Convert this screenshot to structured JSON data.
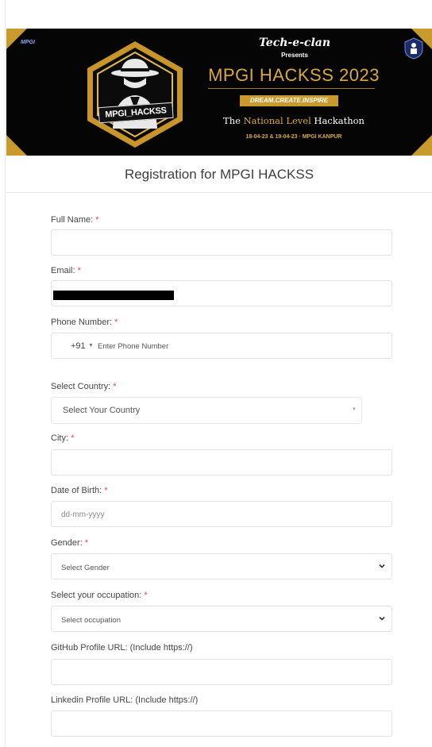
{
  "banner": {
    "org": "Tech-e-clan",
    "presents": "Presents",
    "event_title": "MPGI HACKSS 2023",
    "tagline": "DREAM.CREATE.INSPIRE",
    "national_prefix": "The ",
    "national_highlight": "National Level",
    "national_suffix": " Hackathon",
    "dates": "18-04-23 & 19-04-23  ·  MPGI KANPUR",
    "hex_label": "MPGI_HACKSS",
    "left_logo": "MPGI",
    "right_logo_text": "TECH-E-CLAN",
    "colors": {
      "gold": "#c99a2e",
      "title_gold": "#d8a93f",
      "background": "#050505"
    }
  },
  "form": {
    "title": "Registration for MPGI HACKSS",
    "required_marker": "*",
    "full_name": {
      "label": "Full Name: ",
      "value": ""
    },
    "email": {
      "label": "Email: ",
      "value": "[redacted]"
    },
    "phone": {
      "label": "Phone Number: ",
      "country_code": "+91",
      "placeholder": "Enter Phone Number"
    },
    "country": {
      "label": "Select Country: ",
      "selected": "Select Your Country"
    },
    "city": {
      "label": "City: ",
      "value": ""
    },
    "dob": {
      "label": "Date of Birth: ",
      "placeholder": "dd-mm-yyyy"
    },
    "gender": {
      "label": "Gender: ",
      "selected": "Select Gender"
    },
    "occupation": {
      "label": "Select your occupation: ",
      "selected": "Select occupation"
    },
    "github": {
      "label": "GitHub Profile URL: (Include https://)",
      "value": ""
    },
    "linkedin": {
      "label": "Linkedin Profile URL: (Include https://)",
      "value": ""
    },
    "required_color": "#e0454f"
  }
}
